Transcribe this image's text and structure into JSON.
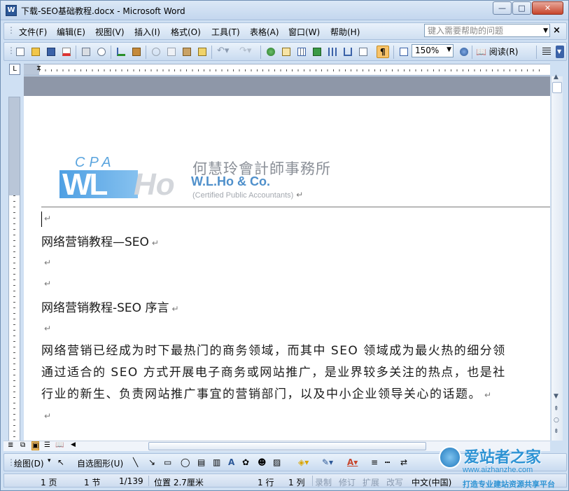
{
  "window": {
    "title": "下载-SEO基础教程.docx - Microsoft Word",
    "app_icon": "W"
  },
  "menu": {
    "items": [
      "文件(F)",
      "编辑(E)",
      "视图(V)",
      "插入(I)",
      "格式(O)",
      "工具(T)",
      "表格(A)",
      "窗口(W)",
      "帮助(H)"
    ],
    "help_placeholder": "键入需要帮助的问题"
  },
  "toolbar": {
    "zoom": "150%",
    "read_label": "阅读(R)"
  },
  "document": {
    "logo": {
      "cpa": "CPA",
      "wl": "WL",
      "ho": "Ho",
      "chinese_name": "何慧玲會計師事務所",
      "english_name": "W.L.Ho & Co.",
      "tagline": "(Certified Public Accountants)"
    },
    "pilcrow": "↵",
    "paragraphs": [
      "网络营销教程—SEO",
      "",
      "",
      "网络营销教程-SEO  序言",
      "",
      "网络营销已经成为时下最热门的商务领域，而其中 SEO 领域成为最火热的细分领",
      "通过适合的 SEO 方式开展电子商务或网站推广，是业界较多关注的热点，也是社",
      "行业的新生、负责网站推广事宜的营销部门，以及中小企业领导关心的话题。",
      ""
    ]
  },
  "drawbar": {
    "draw_label": "绘图(D)",
    "autoshape_label": "自选图形(U)"
  },
  "status": {
    "page": "1 页",
    "section": "1 节",
    "pages": "1/139",
    "position": "位置 2.7厘米",
    "line": "1 行",
    "col": "1 列",
    "rec": "录制",
    "rev": "修订",
    "ext": "扩展",
    "ovr": "改写",
    "lang": "中文(中国)"
  },
  "watermark": {
    "title": "爱站者之家",
    "url": "www.aizhanzhe.com",
    "slogan": "打造专业建站资源共享平台"
  },
  "colors": {
    "titlebar": "#cfe0f3",
    "accent": "#4f90cb",
    "close": "#c7452c"
  }
}
